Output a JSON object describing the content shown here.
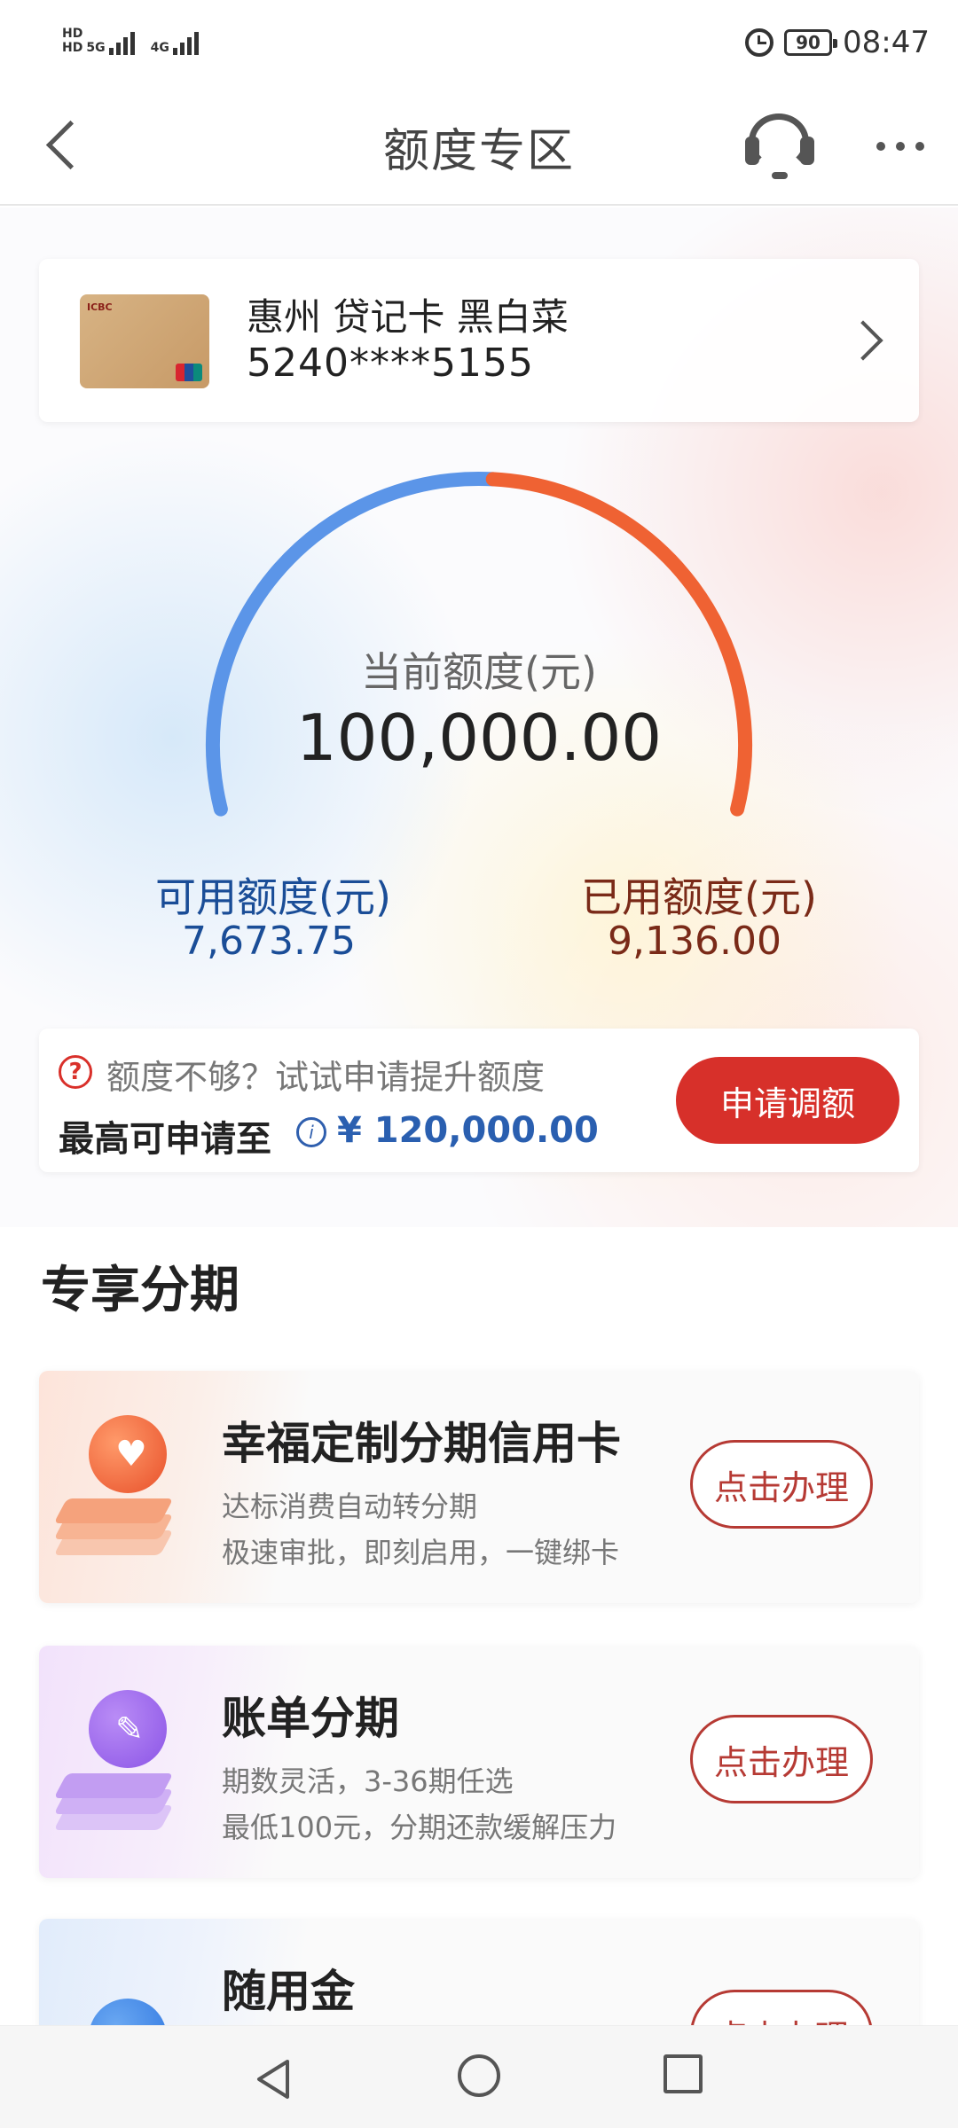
{
  "status_bar": {
    "sim1": "HD",
    "sim1_net": "5G",
    "sim2": "HD",
    "sim2_net": "4G",
    "battery": "90",
    "time": "08:47"
  },
  "header": {
    "title": "额度专区",
    "back_icon": "back-arrow-icon",
    "service_icon": "headset-icon",
    "more_icon": "more-icon"
  },
  "card": {
    "name": "惠州 贷记卡 黑白菜",
    "number": "5240****5155"
  },
  "limit": {
    "title": "当前额度(元)",
    "total": "100,000.00",
    "available_label": "可用额度(元)",
    "available": "7,673.75",
    "used_label": "已用额度(元)",
    "used": "9,136.00",
    "available_color": "#5b95e8",
    "used_color": "#ef6233"
  },
  "increase": {
    "tip": "额度不够？试试申请提升额度",
    "prefix": "最高可申请至",
    "amount": "¥ 120,000.00",
    "button": "申请调额"
  },
  "section": {
    "title": "专享分期"
  },
  "installments": [
    {
      "title": "幸福定制分期信用卡",
      "line1": "达标消费自动转分期",
      "line2": "极速审批，即刻启用，一键绑卡",
      "button": "点击办理",
      "icon": "heart-icon"
    },
    {
      "title": "账单分期",
      "line1": "期数灵活，3-36期任选",
      "line2": "最低100元，分期还款缓解压力",
      "button": "点击办理",
      "icon": "pencil-icon"
    },
    {
      "title": "随用金",
      "button": "点击办理",
      "icon": "rocket-icon"
    }
  ]
}
